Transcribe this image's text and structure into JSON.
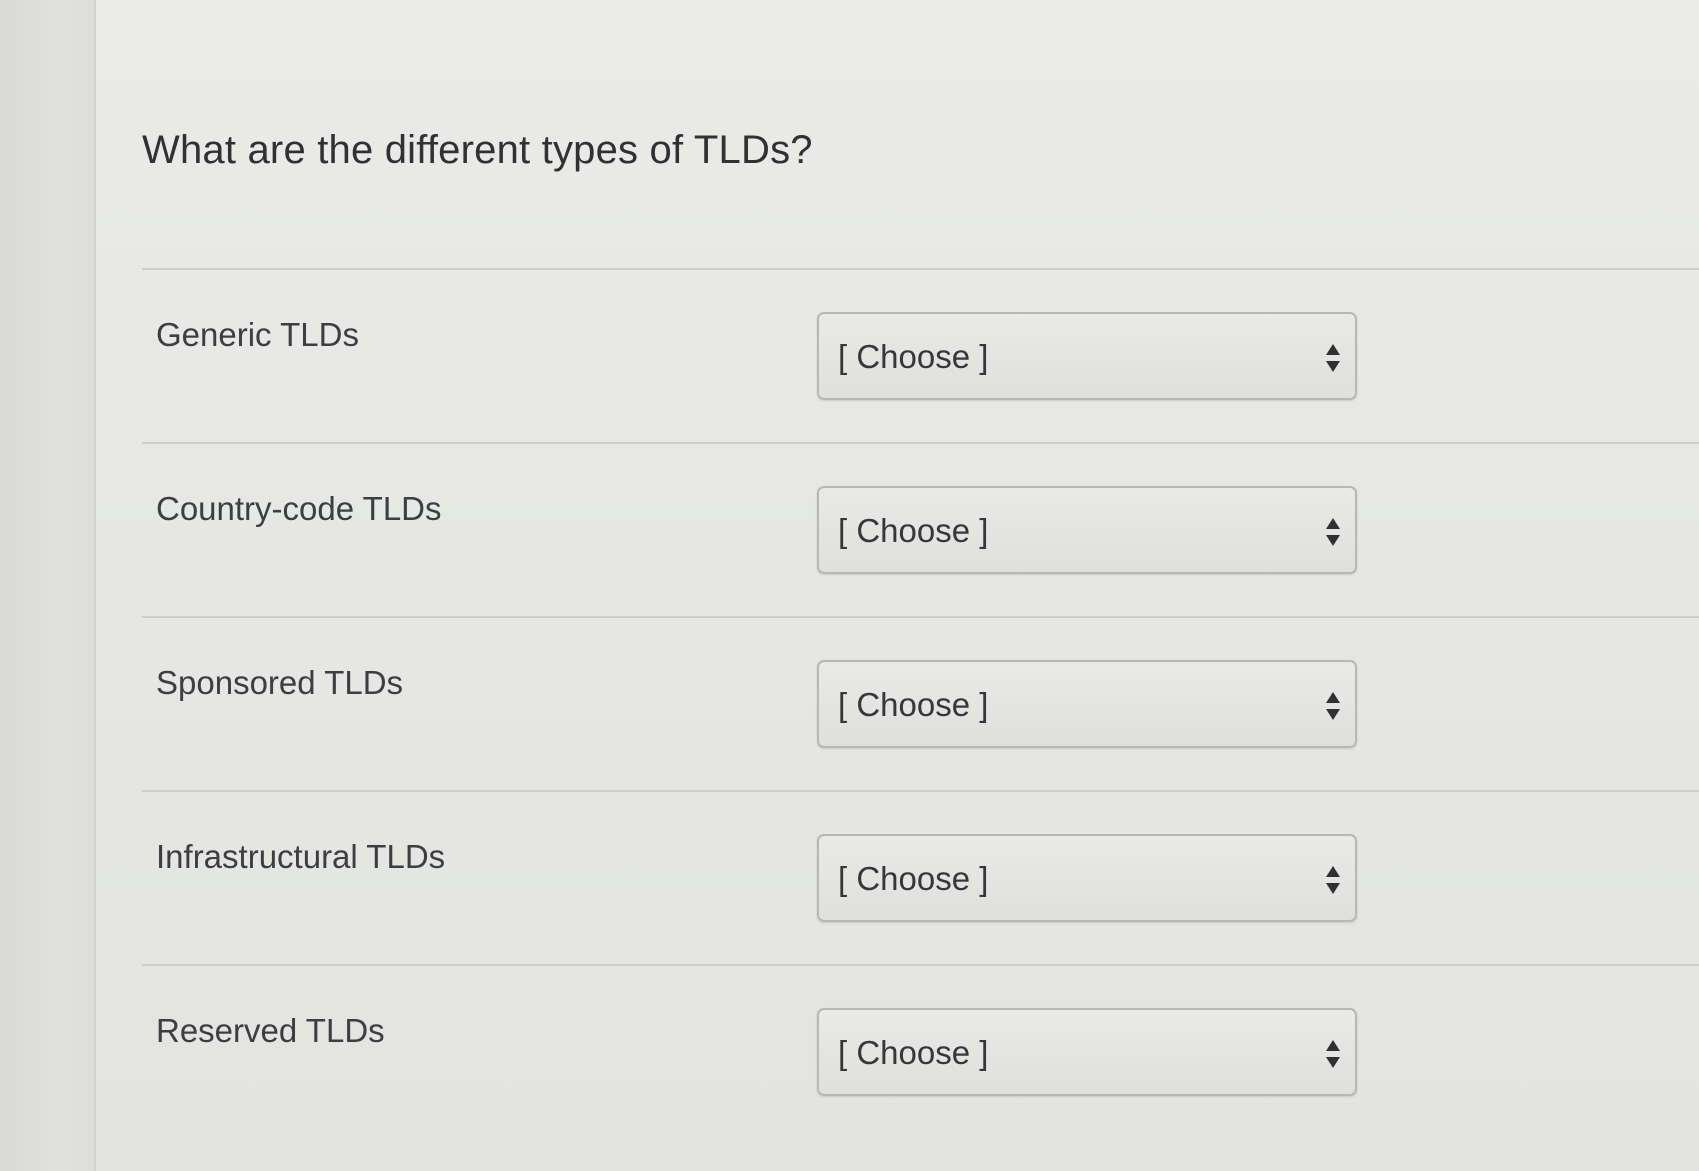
{
  "question": {
    "title": "What are the different types of TLDs?"
  },
  "rows": [
    {
      "term": "Generic TLDs",
      "selected": "[ Choose ]"
    },
    {
      "term": "Country-code TLDs",
      "selected": "[ Choose ]"
    },
    {
      "term": "Sponsored TLDs",
      "selected": "[ Choose ]"
    },
    {
      "term": "Infrastructural TLDs",
      "selected": "[ Choose ]"
    },
    {
      "term": "Reserved TLDs",
      "selected": "[ Choose ]"
    }
  ],
  "icons": {
    "select_arrows": "up-down-arrows-icon"
  },
  "colors": {
    "background": "#e6e7e5",
    "text": "#3b3d3f",
    "select_border": "#b7b8b6"
  }
}
